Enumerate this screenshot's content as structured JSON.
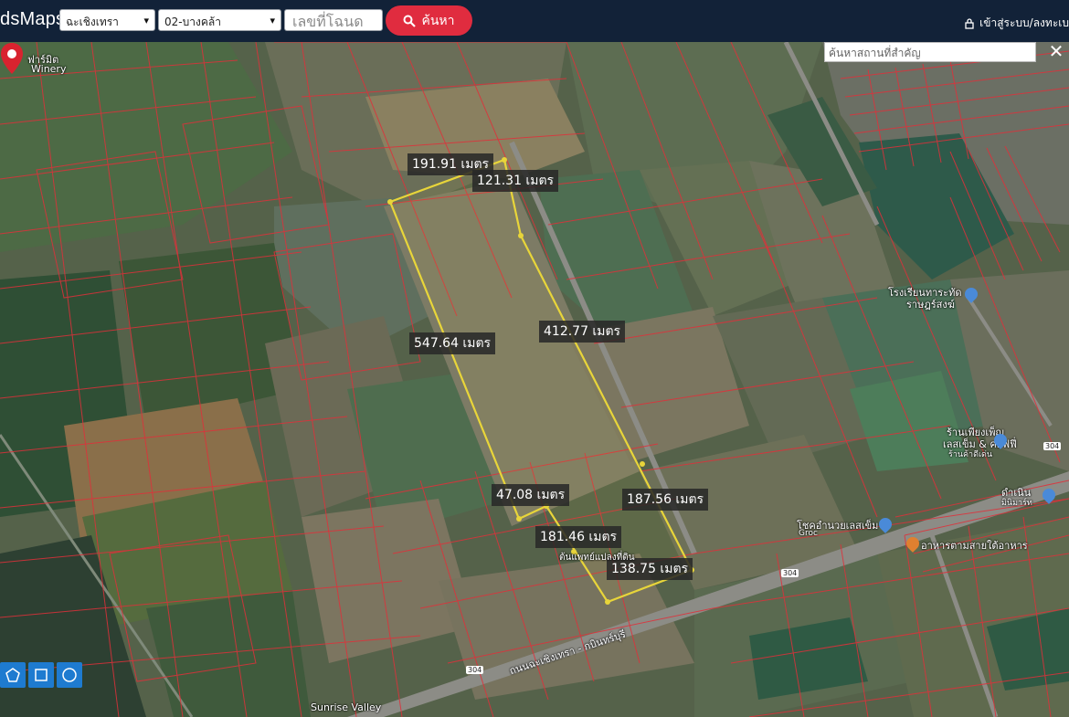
{
  "header": {
    "brand": "dsMaps",
    "province_select": "ฉะเชิงเทรา",
    "district_select": "02-บางคล้า",
    "deed_placeholder": "เลขที่โฉนด",
    "search_label": "ค้นหา",
    "login_label": "เข้าสู่ระบบ/ลงทะเบ"
  },
  "map": {
    "place_search_placeholder": "ค้นหาสถานที่สำคัญ",
    "close_label": "✕",
    "measurements": [
      "191.91 เมตร",
      "121.31 เมตร",
      "547.64 เมตร",
      "412.77 เมตร",
      "47.08 เมตร",
      "187.56 เมตร",
      "181.46 เมตร",
      "138.75 เมตร"
    ],
    "places": {
      "winery_1": "ฟาร์มิต",
      "winery_2": "Winery",
      "school_1": "โรงเรียนทาระทัด",
      "school_2": "ราษฎร์สงฆ์",
      "shop_1": "ร้านเพียงเพ็ญ",
      "shop_2": "เลสเข็ม & คอฟฟี่",
      "shop_3": "ร้านค้าดีเด่น",
      "grocery_1": "โชคอำนวยเลสเข็ม",
      "grocery_2": "Groc",
      "food": "อาหารตามสายใต้อาหาร",
      "roadname": "ถนนฉะเชิงเทรา - กบินทร์บุรี",
      "near_pin": "ต้นแพทย์แปลงที่ดิน",
      "shop_right": "ดำเนิน",
      "shop_right2": "มินิมาร์ท",
      "sunrise": "Sunrise Valley"
    },
    "road_shields": [
      "304",
      "304",
      "304"
    ]
  },
  "tools": [
    "polygon-tool",
    "rectangle-tool",
    "circle-tool"
  ],
  "colors": {
    "topbar": "#122238",
    "search_button": "#e02c3f",
    "plot_outline": "#e8d53a",
    "parcel_lines": "#e0303a",
    "tool_button": "#1e7bd0",
    "pin": "#d8232f"
  }
}
